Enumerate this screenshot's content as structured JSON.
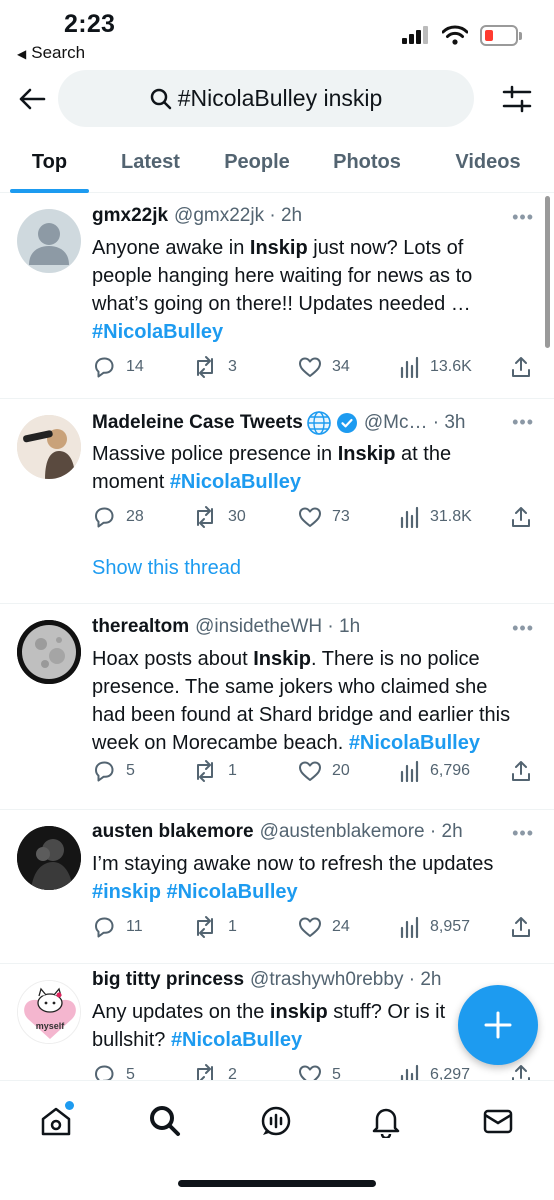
{
  "status_bar": {
    "time": "2:23",
    "back_label": "Search"
  },
  "search": {
    "query": "#NicolaBulley inskip"
  },
  "tabs": [
    "Top",
    "Latest",
    "People",
    "Photos",
    "Videos"
  ],
  "tweets": [
    {
      "name": "gmx22jk",
      "meta": "@gmx22jk · 2h",
      "body_lines": [
        [
          {
            "t": "Anyone awake in "
          },
          {
            "t": "Inskip",
            "b": true
          },
          {
            "t": " just now? Lots of"
          }
        ],
        [
          {
            "t": "people hanging here waiting for news as to"
          }
        ],
        [
          {
            "t": "what’s going on there!! Updates needed …"
          }
        ],
        [
          {
            "t": "#NicolaBulley",
            "h": true
          }
        ]
      ],
      "replies": "14",
      "retweets": "3",
      "likes": "34",
      "views": "13.6K"
    },
    {
      "name": "Madeleine Case Tweets",
      "meta": "@Mc… · 3h",
      "body_lines": [
        [
          {
            "t": "Massive police presence in "
          },
          {
            "t": "Inskip",
            "b": true
          },
          {
            "t": " at the"
          }
        ],
        [
          {
            "t": "moment "
          },
          {
            "t": "#NicolaBulley",
            "h": true
          }
        ]
      ],
      "replies": "28",
      "retweets": "30",
      "likes": "73",
      "views": "31.8K",
      "show_thread": "Show this thread"
    },
    {
      "name": "therealtom",
      "meta": "@insidetheWH · 1h",
      "body_lines": [
        [
          {
            "t": "Hoax posts about "
          },
          {
            "t": "Inskip",
            "b": true
          },
          {
            "t": ". There is no police"
          }
        ],
        [
          {
            "t": "presence. The same jokers who claimed she"
          }
        ],
        [
          {
            "t": "had been found at Shard bridge and earlier this"
          }
        ],
        [
          {
            "t": "week on Morecambe beach. "
          },
          {
            "t": "#NicolaBulley",
            "h": true
          }
        ]
      ],
      "replies": "5",
      "retweets": "1",
      "likes": "20",
      "views": "6,796"
    },
    {
      "name": "austen blakemore",
      "meta": "@austenblakemore · 2h",
      "body_lines": [
        [
          {
            "t": "I’m staying awake now to refresh the updates"
          }
        ],
        [
          {
            "t": "#inskip",
            "h": true
          },
          {
            "t": " "
          },
          {
            "t": "#NicolaBulley",
            "h": true
          }
        ]
      ],
      "replies": "11",
      "retweets": "1",
      "likes": "24",
      "views": "8,957"
    },
    {
      "name": "big titty princess",
      "meta": "@trashywh0rebby · 2h",
      "avatar_text": "myself",
      "body_lines": [
        [
          {
            "t": "Any updates on the "
          },
          {
            "t": "inskip",
            "b": true
          },
          {
            "t": " stuff? Or is it"
          }
        ],
        [
          {
            "t": "bullshit? "
          },
          {
            "t": "#NicolaBulley",
            "h": true
          }
        ]
      ],
      "replies": "5",
      "retweets": "2",
      "likes": "5",
      "views": "6,297"
    }
  ],
  "colors": {
    "accent": "#1d9bf0",
    "text": "#0f1419",
    "secondary": "#536471",
    "battery_low": "#ff3b30"
  },
  "icons": [
    "back-arrow-icon",
    "search-icon",
    "filter-icon",
    "reply-icon",
    "retweet-icon",
    "like-icon",
    "views-icon",
    "share-icon",
    "verified-icon",
    "globe-icon",
    "compose-icon",
    "home-icon",
    "spaces-icon",
    "notifications-icon",
    "messages-icon"
  ]
}
